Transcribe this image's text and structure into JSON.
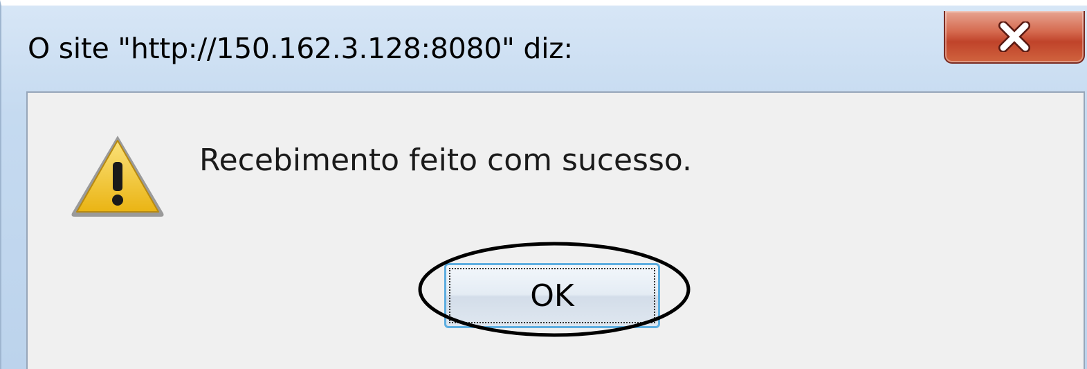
{
  "dialog": {
    "title": "O site \"http://150.162.3.128:8080\" diz:",
    "message": "Recebimento feito com sucesso.",
    "icon": "warning-icon",
    "ok_label": "OK",
    "close_icon": "close-icon"
  },
  "annotation": {
    "shape": "ellipse",
    "target": "ok-button"
  },
  "colors": {
    "close_button": "#c0432a",
    "titlebar": "#c5daf0",
    "content_background": "#f0f0f0",
    "ok_focus_border": "#5eaee0",
    "warning_fill": "#f2c21b",
    "annotation_stroke": "#000000"
  }
}
